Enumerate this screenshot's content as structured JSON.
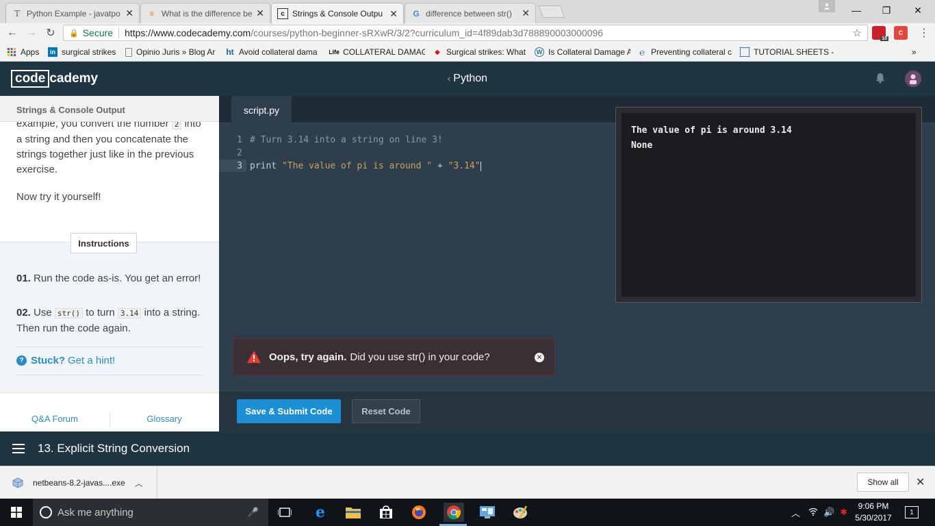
{
  "browser": {
    "tabs": [
      {
        "title": "Python Example - javatpo",
        "favicon": "T"
      },
      {
        "title": "What is the difference be",
        "favicon": "≡"
      },
      {
        "title": "Strings & Console Outpu",
        "favicon": "c"
      },
      {
        "title": "difference between str()",
        "favicon": "G"
      }
    ],
    "address": {
      "secure_label": "Secure",
      "url_host": "https://www.codecademy.com",
      "url_path": "/courses/python-beginner-sRXwR/3/2?curriculum_id=4f89dab3d788890003000096"
    },
    "ext_badge": "10",
    "bookmarks": [
      {
        "label": "Apps"
      },
      {
        "label": "surgical strikes"
      },
      {
        "label": "Opinio Juris » Blog Ar"
      },
      {
        "label": "Avoid collateral dama"
      },
      {
        "label": "COLLATERAL DAMAGE"
      },
      {
        "label": "Surgical strikes: What"
      },
      {
        "label": "Is Collateral Damage A"
      },
      {
        "label": "Preventing collateral c"
      },
      {
        "label": "TUTORIAL SHEETS - A"
      }
    ],
    "bookmarks_more": "»"
  },
  "header": {
    "logo_boxed": "code",
    "logo_rest": "cademy",
    "course": "Python"
  },
  "lesson": {
    "title": "Strings & Console Output",
    "para1_a": "example, you convert the number",
    "para1_code": "2",
    "para1_b": "into a string and then you concatenate the strings together just like in the previous exercise.",
    "para2": "Now try it yourself!",
    "instructions_label": "Instructions",
    "step1_num": "01.",
    "step1_text": "Run the code as-is. You get an error!",
    "step2_num": "02.",
    "step2_a": "Use",
    "step2_code1": "str()",
    "step2_b": "to turn",
    "step2_code2": "3.14",
    "step2_c": "into a string. Then run the code again.",
    "hint_bold": "Stuck?",
    "hint_text": "Get a hint!",
    "footer_qa": "Q&A Forum",
    "footer_glossary": "Glossary"
  },
  "editor": {
    "file_tab": "script.py",
    "line_numbers": [
      "1",
      "2",
      "3"
    ],
    "line1": "# Turn 3.14 into a string on line 3!",
    "line3_kw": "print ",
    "line3_str1": "\"The value of pi is around \"",
    "line3_op": " + ",
    "line3_str2": "\"3.14\""
  },
  "console": {
    "lines": [
      "The value of pi is around 3.14",
      "None"
    ]
  },
  "error": {
    "bold": "Oops, try again.",
    "message": "Did you use str() in your code?"
  },
  "actions": {
    "submit": "Save & Submit Code",
    "reset": "Reset Code"
  },
  "lesson_nav": {
    "name": "13. Explicit String Conversion"
  },
  "downloads": {
    "file": "netbeans-8.2-javas....exe",
    "show_all": "Show all"
  },
  "taskbar": {
    "search_placeholder": "Ask me anything",
    "time": "9:06 PM",
    "date": "5/30/2017"
  },
  "colors": {
    "accent": "#1d8fd6",
    "header": "#1f3542",
    "editor": "#2e3e4c",
    "error_border": "#6b2b2b"
  }
}
